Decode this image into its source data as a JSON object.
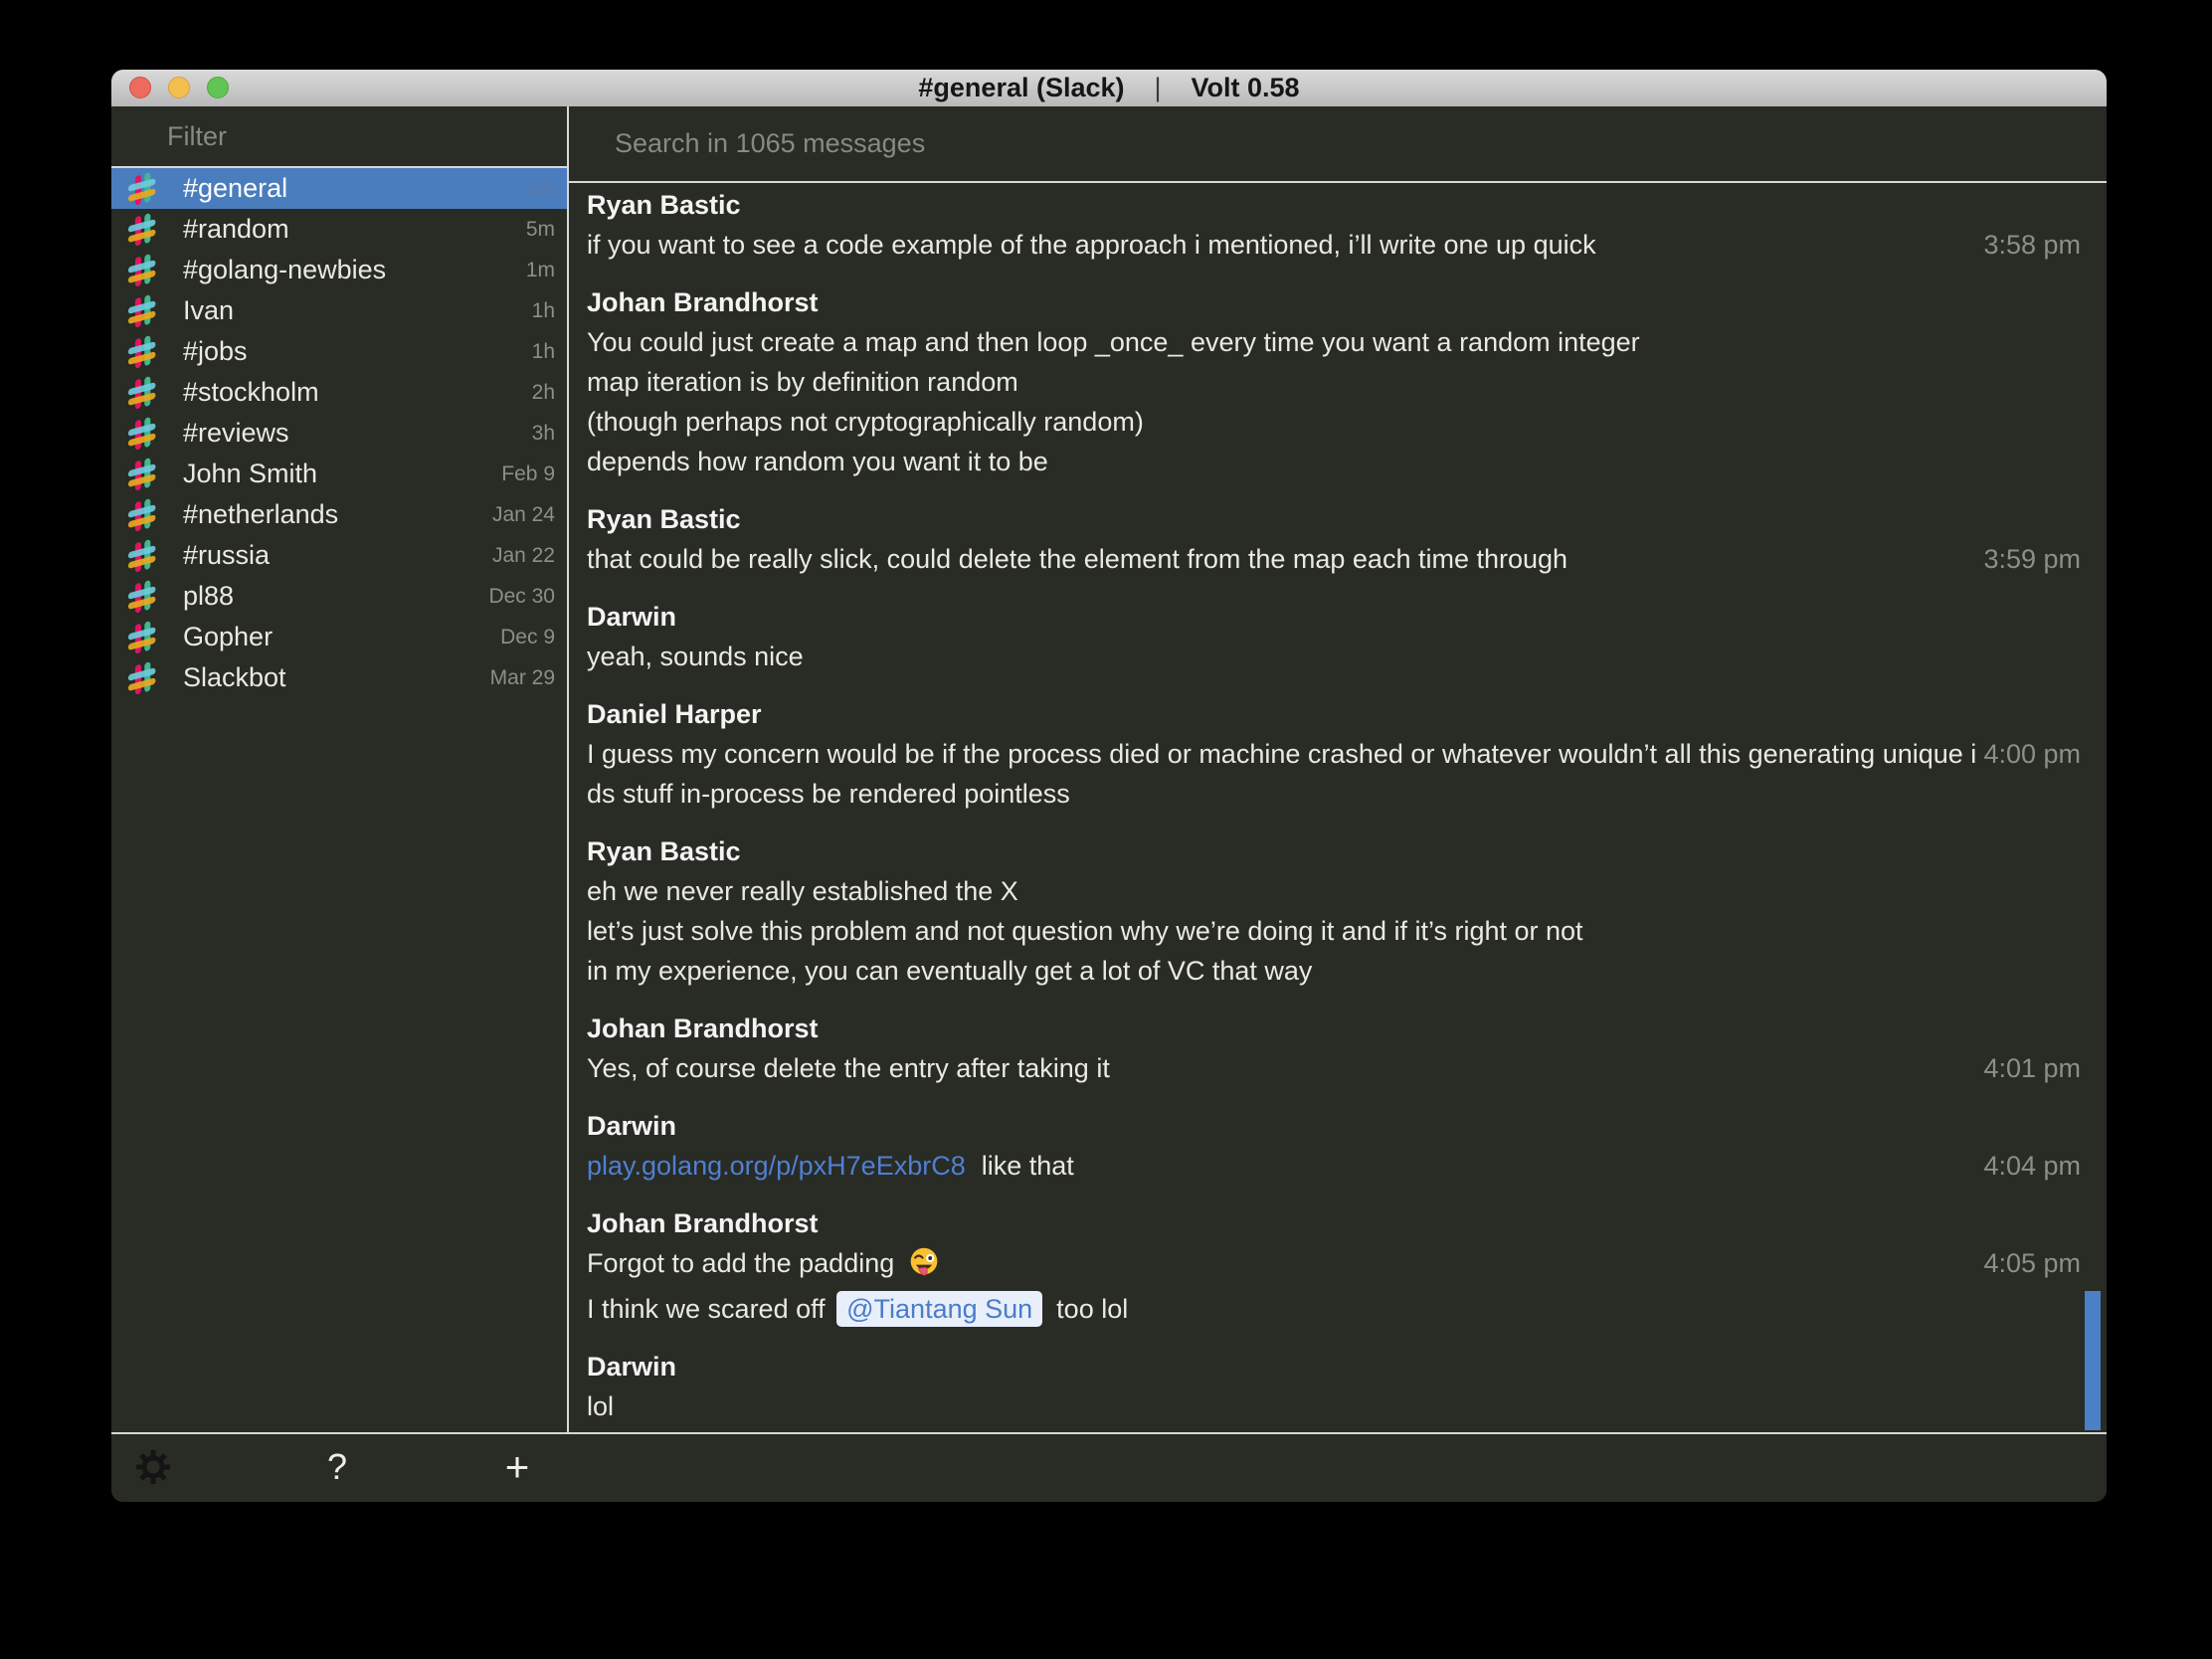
{
  "window": {
    "title_left": "#general (Slack)",
    "title_separator": "|",
    "title_right": "Volt 0.58"
  },
  "sidebar": {
    "filter_placeholder": "Filter",
    "channels": [
      {
        "name": "#general",
        "time": "1m",
        "selected": true
      },
      {
        "name": "#random",
        "time": "5m"
      },
      {
        "name": "#golang-newbies",
        "time": "1m"
      },
      {
        "name": "Ivan",
        "time": "1h"
      },
      {
        "name": "#jobs",
        "time": "1h"
      },
      {
        "name": "#stockholm",
        "time": "2h"
      },
      {
        "name": "#reviews",
        "time": "3h"
      },
      {
        "name": "John Smith",
        "time": "Feb 9"
      },
      {
        "name": "#netherlands",
        "time": "Jan 24"
      },
      {
        "name": "#russia",
        "time": "Jan 22"
      },
      {
        "name": "pl88",
        "time": "Dec 30"
      },
      {
        "name": "Gopher",
        "time": "Dec 9"
      },
      {
        "name": "Slackbot",
        "time": "Mar 29"
      }
    ],
    "toolbar": {
      "settings_icon": "gear-icon",
      "help_label": "?",
      "add_label": "+"
    }
  },
  "main": {
    "search_placeholder": "Search in 1065 messages",
    "messages": [
      {
        "author": "Ryan Bastic",
        "time": "3:58 pm",
        "lines": [
          [
            {
              "t": "text",
              "v": "if you want to see a code example of the approach i mentioned, i’ll write one up quick"
            }
          ]
        ]
      },
      {
        "author": "Johan Brandhorst",
        "lines": [
          [
            {
              "t": "text",
              "v": "You could just create a map and then loop _once_ every time you want a random integer"
            }
          ],
          [
            {
              "t": "text",
              "v": "map iteration is by definition random"
            }
          ],
          [
            {
              "t": "text",
              "v": "(though perhaps not cryptographically random)"
            }
          ],
          [
            {
              "t": "text",
              "v": "depends how random you want it to be"
            }
          ]
        ]
      },
      {
        "author": "Ryan Bastic",
        "time": "3:59 pm",
        "lines": [
          [
            {
              "t": "text",
              "v": "that could be really slick, could delete the element from the map each time through"
            }
          ]
        ]
      },
      {
        "author": "Darwin",
        "lines": [
          [
            {
              "t": "text",
              "v": "yeah, sounds nice"
            }
          ]
        ]
      },
      {
        "author": "Daniel Harper",
        "time": "4:00 pm",
        "lines": [
          [
            {
              "t": "text",
              "v": "I guess my concern would be if the process died or machine crashed or whatever wouldn’t all this generating unique i"
            }
          ],
          [
            {
              "t": "text",
              "v": "ds stuff in-process be rendered pointless"
            }
          ]
        ]
      },
      {
        "author": "Ryan Bastic",
        "lines": [
          [
            {
              "t": "text",
              "v": "eh we never really established the X"
            }
          ],
          [
            {
              "t": "text",
              "v": "let’s just solve this problem and not question why we’re doing it and if it’s right or not"
            }
          ],
          [
            {
              "t": "text",
              "v": "in my experience, you can eventually get a lot of VC that way"
            }
          ]
        ]
      },
      {
        "author": "Johan Brandhorst",
        "time": "4:01 pm",
        "lines": [
          [
            {
              "t": "text",
              "v": "Yes, of course delete the entry after taking it"
            }
          ]
        ]
      },
      {
        "author": "Darwin",
        "time": "4:04 pm",
        "lines": [
          [
            {
              "t": "link",
              "v": "play.golang.org/p/pxH7eExbrC8"
            },
            {
              "t": "text",
              "v": "like that"
            }
          ]
        ]
      },
      {
        "author": "Johan Brandhorst",
        "time": "4:05 pm",
        "lines": [
          [
            {
              "t": "text",
              "v": "Forgot to add the padding"
            },
            {
              "t": "emoji",
              "v": "stuck-out-tongue-winking-eye-emoji"
            }
          ],
          [
            {
              "t": "text",
              "v": "I think we scared off"
            },
            {
              "t": "mention",
              "v": "@Tiantang Sun"
            },
            {
              "t": "text",
              "v": "too lol"
            }
          ]
        ]
      },
      {
        "author": "Darwin",
        "lines": [
          [
            {
              "t": "text",
              "v": "lol"
            }
          ]
        ]
      }
    ]
  },
  "colors": {
    "selected_channel": "#4a7dbe",
    "link": "#4f80d1",
    "mention_bg": "#e8effb",
    "mention_text": "#4a7cc9",
    "scrollbar": "#4a80c6",
    "background": "#292b25",
    "divider": "#d8d8d8",
    "timestamp": "#8c8f87"
  }
}
